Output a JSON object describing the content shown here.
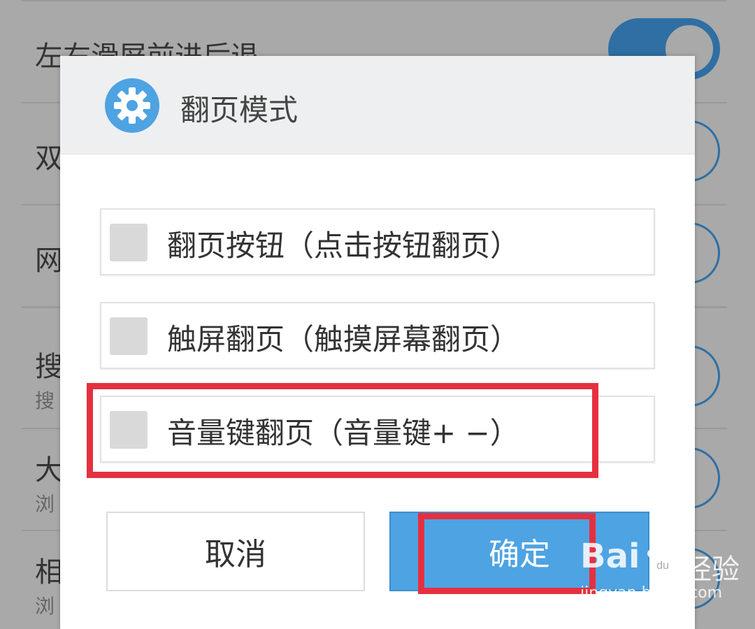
{
  "background": {
    "rows": [
      {
        "title": "左右滑屏前进后退",
        "subtitle": "",
        "toggle_on": true
      },
      {
        "title": "双",
        "subtitle": "",
        "toggle_on": false
      },
      {
        "title": "网",
        "subtitle": "",
        "toggle_on": false
      },
      {
        "title": "搜",
        "subtitle": "搜",
        "toggle_on": false
      },
      {
        "title": "大",
        "subtitle": "浏",
        "toggle_on": false
      },
      {
        "title": "相",
        "subtitle": "浏",
        "toggle_on": false
      }
    ]
  },
  "dialog": {
    "title": "翻页模式",
    "icon": "gear-icon",
    "options": [
      {
        "label": "翻页按钮（点击按钮翻页）",
        "checked": false
      },
      {
        "label": "触屏翻页（触摸屏幕翻页）",
        "checked": false
      },
      {
        "label": "音量键翻页（音量键+ −）",
        "checked": false
      }
    ],
    "cancel_label": "取消",
    "ok_label": "确定"
  },
  "watermark": {
    "logo": "Bai",
    "logo_tail": "du",
    "cn": "经验",
    "url": "jingyan.baidu.com"
  },
  "colors": {
    "accent": "#4ea3e2",
    "toggle": "#2f6fa3",
    "highlight": "#e5303f"
  }
}
